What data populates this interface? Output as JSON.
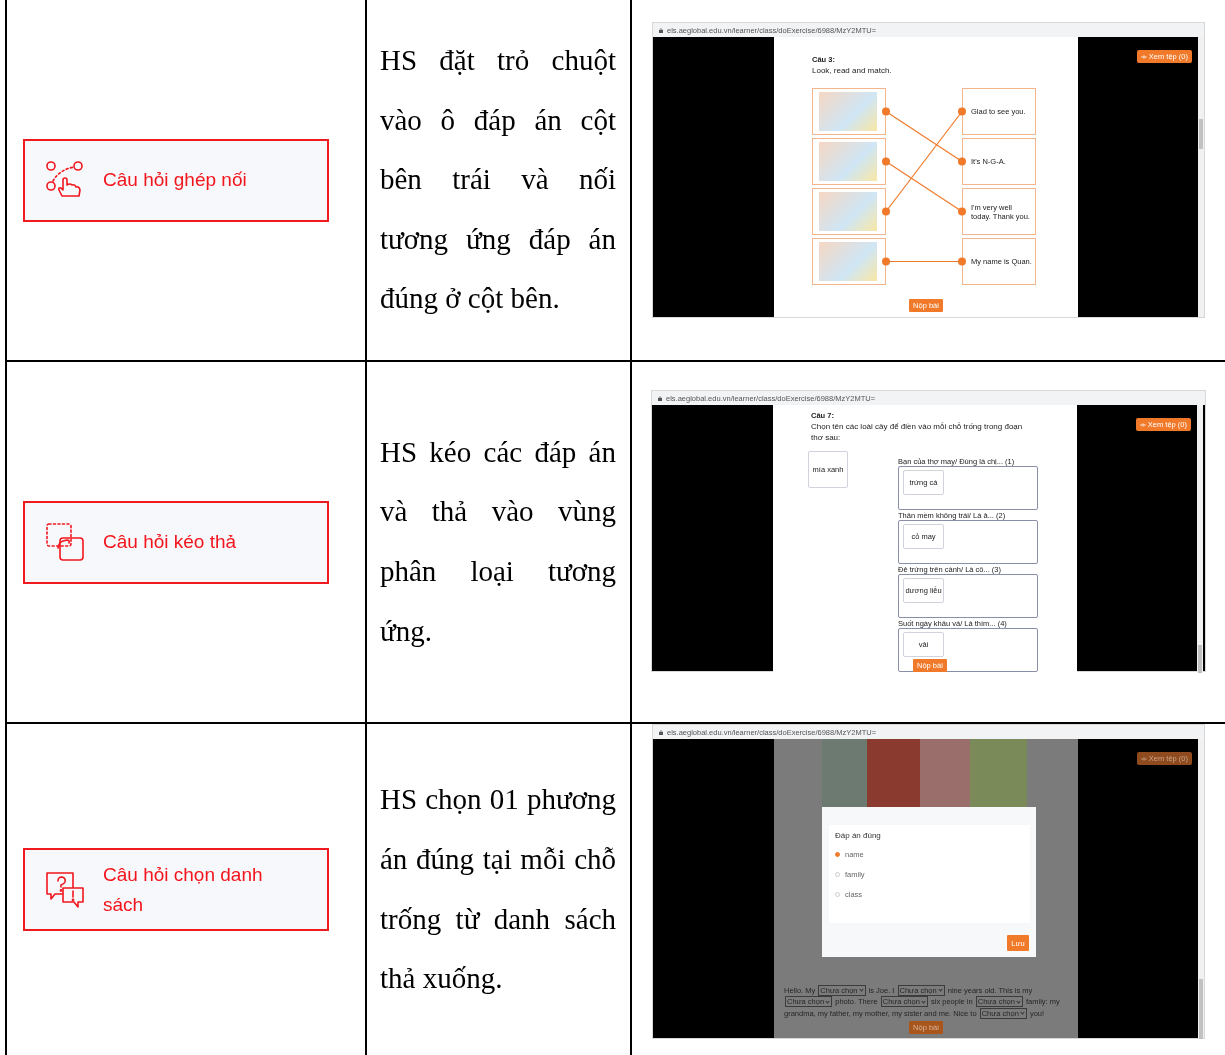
{
  "rows": [
    {
      "kind": "matching",
      "type_button": {
        "label": "Câu hỏi ghép nối"
      },
      "description": "HS đặt trỏ chuột vào ô đáp án cột bên trái và nối tương ứng đáp án đúng ở cột bên.",
      "screenshot": {
        "url": "els.aeglobal.edu.vn/learner/class/doExercise/6988/MzY2MTU=",
        "view_button": "Xem tệp (0)",
        "question_number": "Câu 3:",
        "instruction": "Look, read and match.",
        "left_items": [
          {
            "kind": "down_one"
          },
          {
            "kind": "down_one"
          },
          {
            "kind": "up_two"
          },
          {
            "kind": "straight"
          }
        ],
        "right_items": [
          {
            "text": "Glad to see you."
          },
          {
            "text": "It's N-G-A."
          },
          {
            "text": "I'm very well today. Thank you."
          },
          {
            "text": "My name is Quan."
          }
        ],
        "submit_button": "Nộp bài"
      }
    },
    {
      "kind": "drag_drop",
      "type_button": {
        "label": "Câu hỏi kéo thả"
      },
      "description": "HS kéo các đáp án và thả vào vùng phân loại tương ứng.",
      "screenshot": {
        "url": "els.aeglobal.edu.vn/learner/class/doExercise/6988/MzY2MTU=",
        "view_button": "Xem tệp (0)",
        "question_number": "Câu 7:",
        "instruction": "Chọn tên các loài cây để điền vào mỗi chỗ trống trong đoạn thơ sau:",
        "source_cards": [
          "mía xanh"
        ],
        "slots": [
          {
            "prompt": "Bạn của thợ may/ Đúng là chị... (1)",
            "answer": "trứng cá"
          },
          {
            "prompt": "Thân mềm không trái/ Là ả... (2)",
            "answer": "cỏ may"
          },
          {
            "prompt": "Đẻ trứng trên cành/ Là cô... (3)",
            "answer": "dương liễu"
          },
          {
            "prompt": "Suốt ngày khâu vá/ Là thím... (4)",
            "answer": "vải"
          }
        ],
        "submit_button": "Nộp bài"
      }
    },
    {
      "kind": "dropdown",
      "type_button": {
        "label": "Câu hỏi chọn danh sách"
      },
      "description": "HS chọn 01 phương án đúng tại mỗi chỗ trống từ danh sách thả xuống.",
      "screenshot": {
        "url": "els.aeglobal.edu.vn/learner/class/doExercise/6988/MzY2MTU=",
        "view_button": "Xem tệp (0)",
        "dialog": {
          "title": "Đáp án đúng",
          "options": [
            {
              "label": "name",
              "selected": true
            },
            {
              "label": "family",
              "selected": false
            },
            {
              "label": "class",
              "selected": false
            }
          ],
          "save_button": "Lưu"
        },
        "passage": [
          {
            "kind": "text",
            "text": "Hello. My"
          },
          {
            "kind": "select",
            "text": "Chưa chọn"
          },
          {
            "kind": "text",
            "text": "is Joe. I"
          },
          {
            "kind": "select",
            "text": "Chưa chọn"
          },
          {
            "kind": "text",
            "text": "nine years old. This is my"
          },
          {
            "kind": "select",
            "text": "Chưa chọn"
          },
          {
            "kind": "text",
            "text": "photo. There"
          },
          {
            "kind": "select",
            "text": "Chưa chọn"
          },
          {
            "kind": "text",
            "text": "six people in"
          },
          {
            "kind": "select",
            "text": "Chưa chọn"
          },
          {
            "kind": "text",
            "text": "family: my grandma, my father, my mother, my sister and me. Nice to"
          },
          {
            "kind": "select",
            "text": "Chưa chọn"
          },
          {
            "kind": "text",
            "text": "you!"
          }
        ],
        "submit_button": "Nộp bài"
      }
    }
  ]
}
